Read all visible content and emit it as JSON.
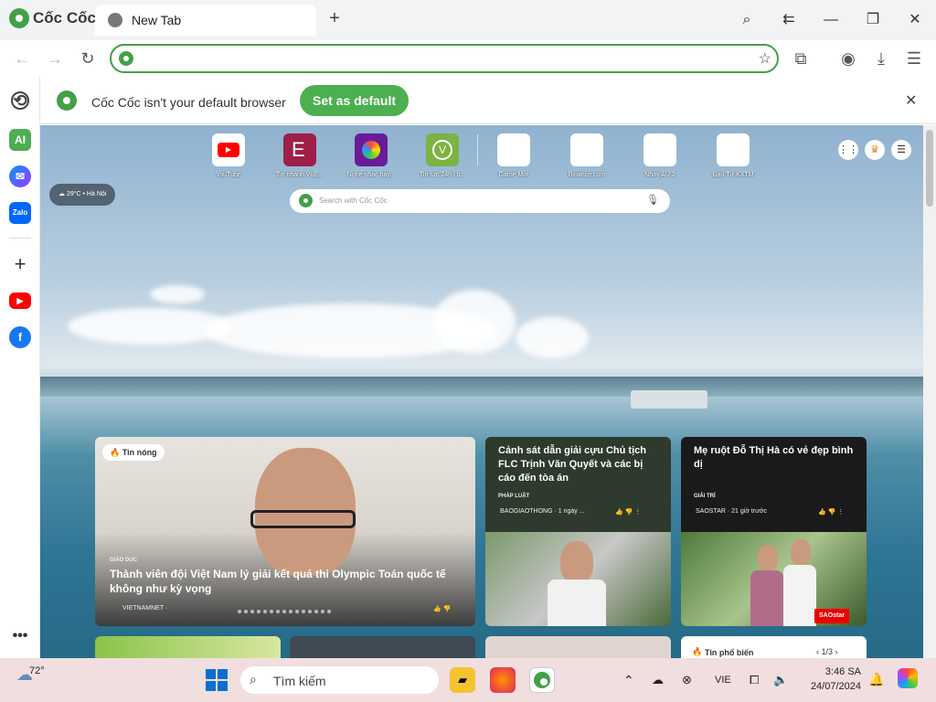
{
  "browser": {
    "name": "Cốc Cốc",
    "tab_title": "New Tab",
    "address_value": "",
    "infobar_text": "Cốc Cốc isn't your default browser",
    "set_default_label": "Set as default"
  },
  "speed_dial": [
    {
      "label": "YouTube",
      "icon": "youtube-icon"
    },
    {
      "label": "Tin nhanh VnE...",
      "icon": "vnexpress-icon"
    },
    {
      "label": "Nghe nhạc hay...",
      "icon": "music-icon"
    },
    {
      "label": "Tin tức 24h | ti...",
      "icon": "news24h-icon"
    },
    {
      "label": "Game Mới",
      "icon": "placeholder-icon"
    },
    {
      "label": "Binance.com",
      "icon": "placeholder-icon"
    },
    {
      "label": "Nhảy AU 2",
      "icon": "placeholder-icon"
    },
    {
      "label": "Đầu Tư KXTM",
      "icon": "placeholder-icon"
    }
  ],
  "weather": "29°C • Hà Nội",
  "search": {
    "placeholder": "Search with Cốc Cốc"
  },
  "news": {
    "hot_badge": "Tin nóng",
    "big": {
      "category": "GIÁO DỤC",
      "title": "Thành viên đội Việt Nam lý giải kết quả thi Olympic Toán quốc tế không như kỳ vọng",
      "source": "VIETNAMNET ·"
    },
    "card2": {
      "title": "Cảnh sát dẫn giải cựu Chủ tịch FLC Trịnh Văn Quyết và các bị cáo đến tòa án",
      "category": "PHÁP LUẬT",
      "source": "BAOGIAOTHONG · 1 ngày ..."
    },
    "card3": {
      "title": "Mẹ ruột Đỗ Thị Hà có vẻ đẹp bình dị",
      "category": "GIẢI TRÍ",
      "source": "SAOSTAR · 21 giờ trước",
      "watermark": "SAOstar"
    },
    "popular_label": "Tin phổ biến",
    "popular_page": "1/3"
  },
  "taskbar": {
    "temp": "72°",
    "search_placeholder": "Tìm kiếm",
    "lang": "VIE",
    "time": "3:46 SA",
    "date": "24/07/2024"
  }
}
